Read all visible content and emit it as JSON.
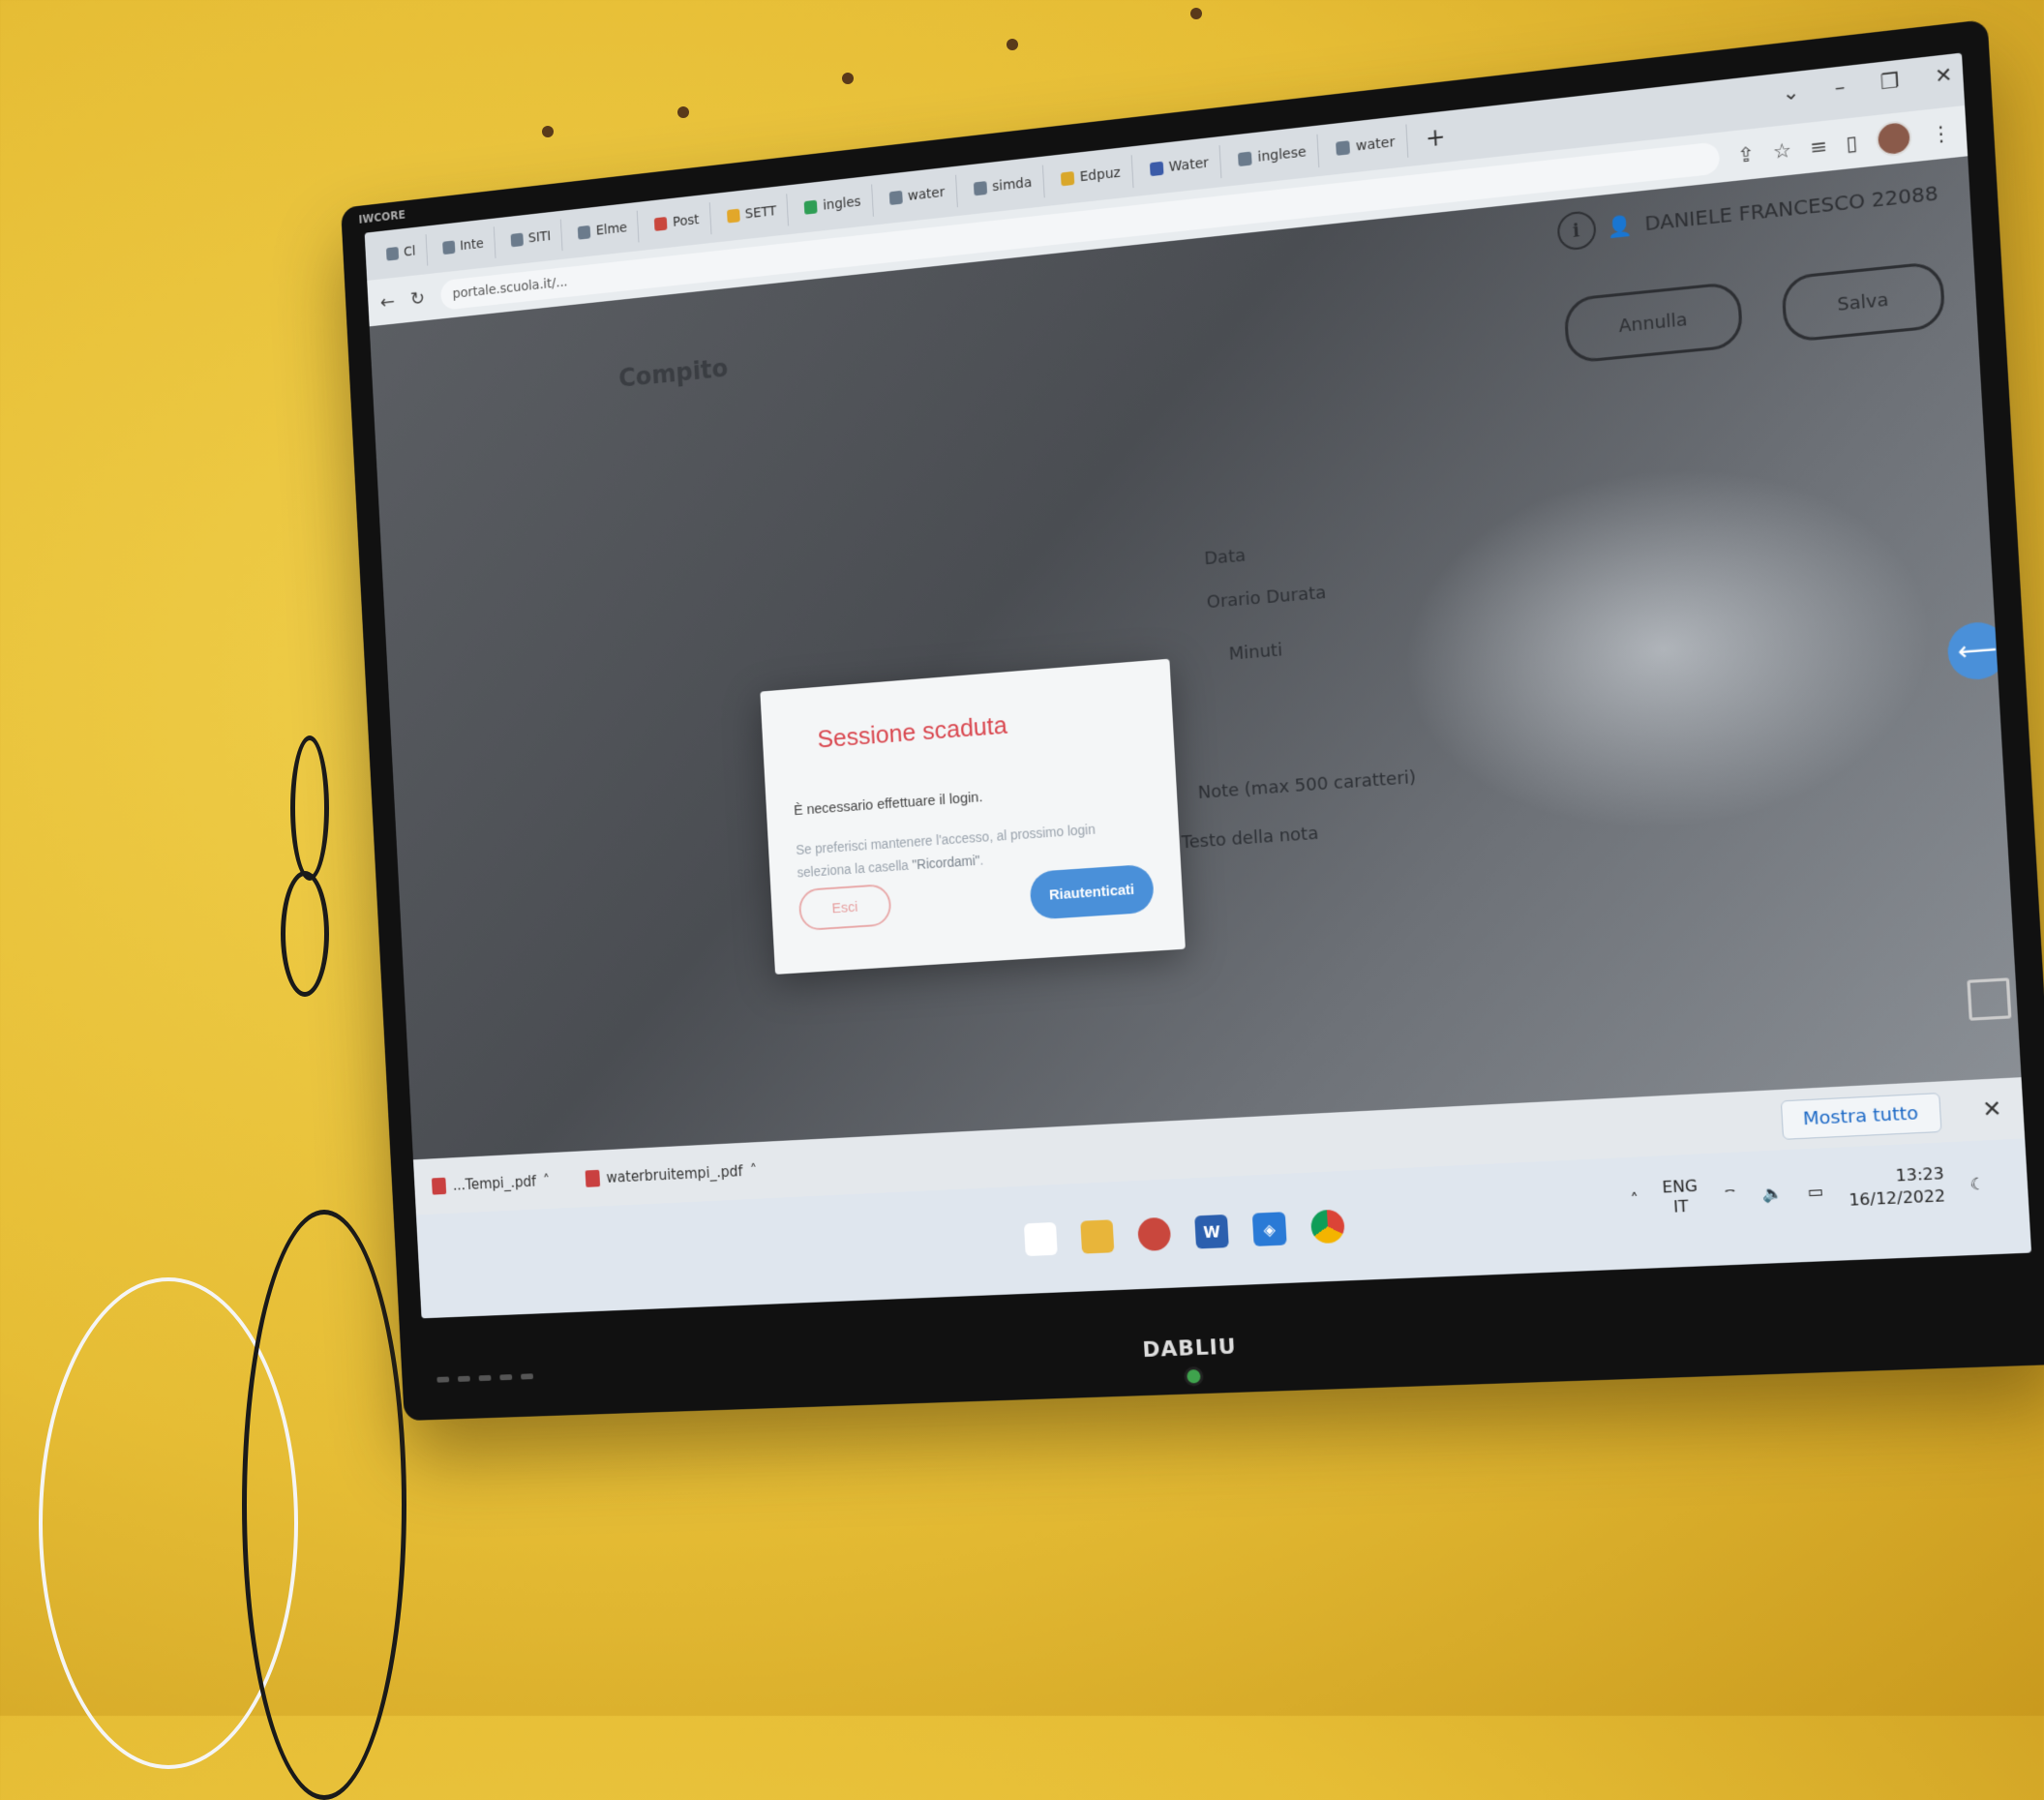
{
  "monitor": {
    "brand_top": "IWCORE",
    "brand_bottom": "DABLIU"
  },
  "browser": {
    "tabs": [
      {
        "label": "Cl"
      },
      {
        "label": "Inte"
      },
      {
        "label": "SITI"
      },
      {
        "label": "Elme"
      },
      {
        "label": "Post"
      },
      {
        "label": "SETT"
      },
      {
        "label": "ingles"
      },
      {
        "label": "water"
      },
      {
        "label": "simda"
      },
      {
        "label": "Edpuz"
      },
      {
        "label": "Water"
      },
      {
        "label": "inglese"
      },
      {
        "label": "water"
      }
    ],
    "new_tab": "+",
    "url": "portale.scuola.it/..."
  },
  "page": {
    "user_name": "DANIELE FRANCESCO 22088",
    "btn_annulla": "Annulla",
    "btn_salva": "Salva",
    "heading": "Compito",
    "text_data": "Data",
    "text_ora": "Orario  Durata",
    "text_minuti": "Minuti",
    "text_note": "Note (max 500 caratteri)",
    "text_testo": "Testo della nota"
  },
  "modal": {
    "title": "Sessione scaduta",
    "body": "È necessario effettuare il login.",
    "hint_prefix": "Se preferisci mantenere l'accesso, al prossimo login seleziona la casella ",
    "hint_highlight": "\"Ricordami\"",
    "hint_suffix": ".",
    "btn_exit": "Esci",
    "btn_reauth": "Riautenticati"
  },
  "downloads": {
    "items": [
      {
        "label": "...Tempi_.pdf"
      },
      {
        "label": "waterbruitempi_.pdf"
      }
    ],
    "show_all": "Mostra tutto",
    "close": "✕"
  },
  "taskbar": {
    "lang_top": "ENG",
    "lang_bottom": "IT",
    "time": "13:23",
    "date": "16/12/2022"
  }
}
